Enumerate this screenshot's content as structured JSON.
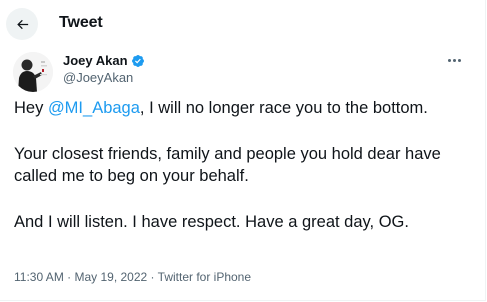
{
  "header": {
    "back_icon": "arrow-left-icon",
    "title": "Tweet"
  },
  "author": {
    "name": "Joey Akan",
    "verified_icon": "verified-badge-icon",
    "handle": "@JoeyAkan",
    "more_icon": "more-horizontal-icon"
  },
  "tweet": {
    "p1_before": "Hey ",
    "p1_mention": "@MI_Abaga",
    "p1_after": ", I will no longer race you to the bottom.",
    "p2": "Your closest friends, family and people you hold dear have called me to beg on your behalf.",
    "p3": "And I will listen. I have respect. Have a great day, OG."
  },
  "meta": {
    "time": "11:30 AM",
    "separator": " · ",
    "date": "May 19, 2022",
    "source": "Twitter for iPhone"
  },
  "colors": {
    "accent": "#1d9bf0",
    "text": "#0f1419",
    "secondary": "#536471"
  }
}
